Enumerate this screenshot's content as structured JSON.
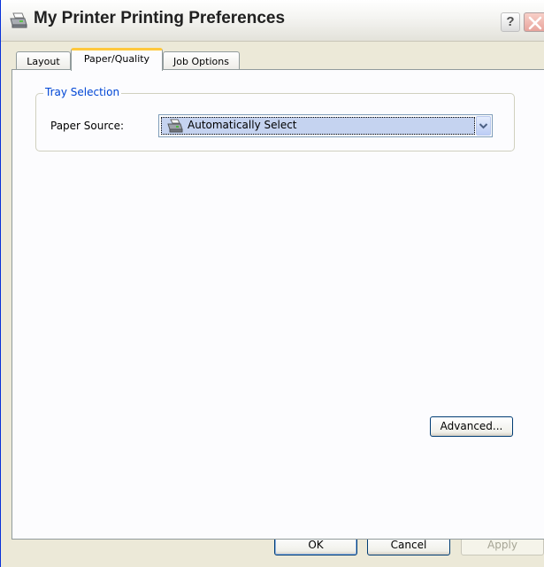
{
  "window": {
    "title": "My Printer Printing Preferences",
    "help_label": "?",
    "icon": "printer-icon"
  },
  "tabs": [
    {
      "label": "Layout",
      "active": false
    },
    {
      "label": "Paper/Quality",
      "active": true
    },
    {
      "label": "Job Options",
      "active": false
    }
  ],
  "tray_selection": {
    "legend": "Tray Selection",
    "paper_source_label": "Paper Source:",
    "paper_source_value": "Automatically Select",
    "value_icon": "printer-icon"
  },
  "buttons": {
    "advanced": "Advanced...",
    "ok": "OK",
    "cancel": "Cancel",
    "apply": "Apply"
  },
  "colors": {
    "accent_tab": "#ffc83c",
    "legend_text": "#0046d5",
    "close_button": "#e8a49c",
    "window_bg": "#ece9d8"
  }
}
